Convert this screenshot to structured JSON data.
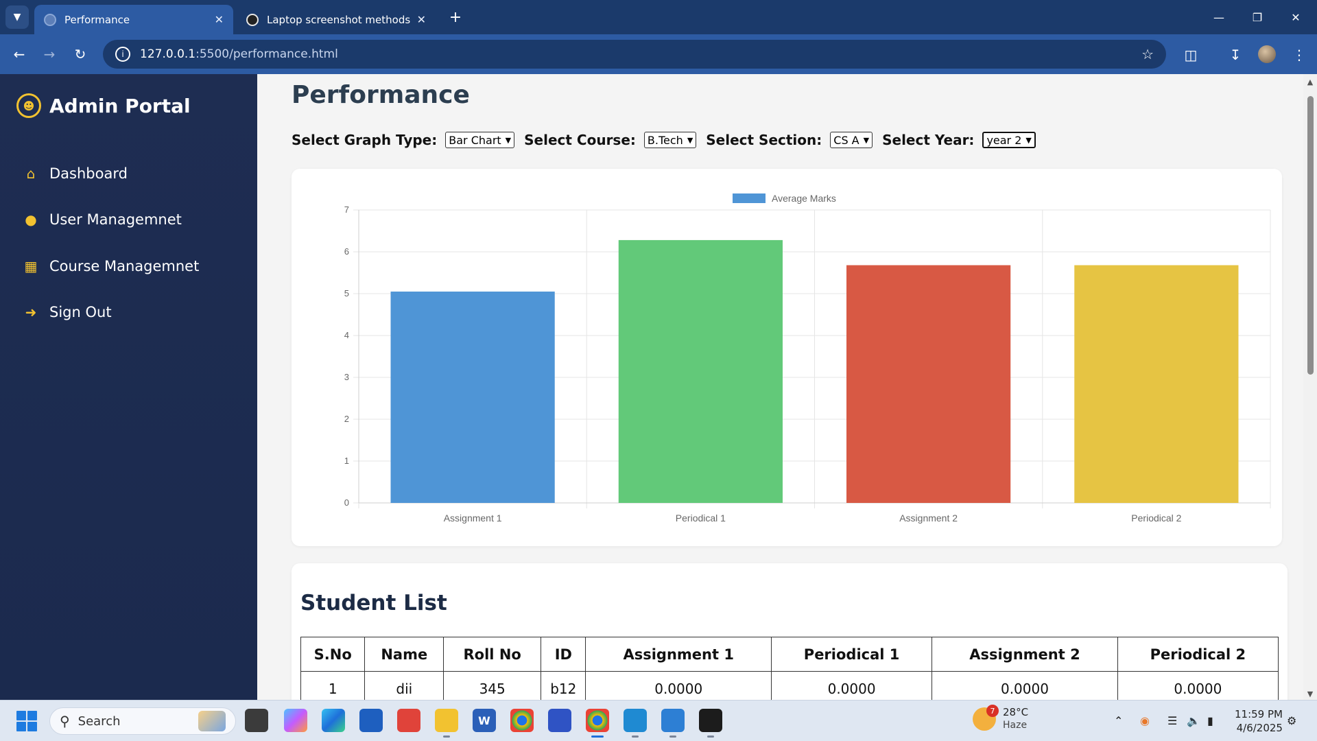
{
  "browser": {
    "tabs": [
      {
        "title": "Performance",
        "active": true
      },
      {
        "title": "Laptop screenshot methods",
        "active": false
      }
    ],
    "url_host": "127.0.0.1",
    "url_path": ":5500/performance.html"
  },
  "sidebar": {
    "brand": "Admin Portal",
    "items": [
      {
        "label": "Dashboard",
        "icon": "home-icon"
      },
      {
        "label": "User Managemnet",
        "icon": "user-icon"
      },
      {
        "label": "Course Managemnet",
        "icon": "book-icon"
      },
      {
        "label": "Sign Out",
        "icon": "sign-out-icon"
      }
    ]
  },
  "main": {
    "title": "Performance",
    "filters": [
      {
        "label": "Select Graph Type:",
        "value": "Bar Chart"
      },
      {
        "label": "Select Course:",
        "value": "B.Tech"
      },
      {
        "label": "Select Section:",
        "value": "CS A"
      },
      {
        "label": "Select Year:",
        "value": "year 2"
      }
    ]
  },
  "chart_data": {
    "type": "bar",
    "categories": [
      "Assignment 1",
      "Periodical 1",
      "Assignment 2",
      "Periodical 2"
    ],
    "series": [
      {
        "name": "Average Marks",
        "values": [
          5.05,
          6.28,
          5.68,
          5.68
        ]
      }
    ],
    "bar_colors": [
      "#4f95d6",
      "#62c979",
      "#d85944",
      "#e6c443"
    ],
    "ylim": [
      0,
      7
    ],
    "yticks": [
      "0",
      "1",
      "2",
      "3",
      "4",
      "5",
      "6",
      "7"
    ],
    "legend_position": "top-center",
    "grid": true
  },
  "student_list": {
    "title": "Student List",
    "columns": [
      "S.No",
      "Name",
      "Roll No",
      "ID",
      "Assignment 1",
      "Periodical 1",
      "Assignment 2",
      "Periodical 2"
    ],
    "rows": [
      [
        "1",
        "dii",
        "345",
        "b12",
        "0.0000",
        "0.0000",
        "0.0000",
        "0.0000"
      ]
    ]
  },
  "taskbar": {
    "search_placeholder": "Search",
    "weather": {
      "temp": "28°C",
      "condition": "Haze",
      "badge": "7"
    },
    "time": "11:59 PM",
    "date": "4/6/2025"
  }
}
